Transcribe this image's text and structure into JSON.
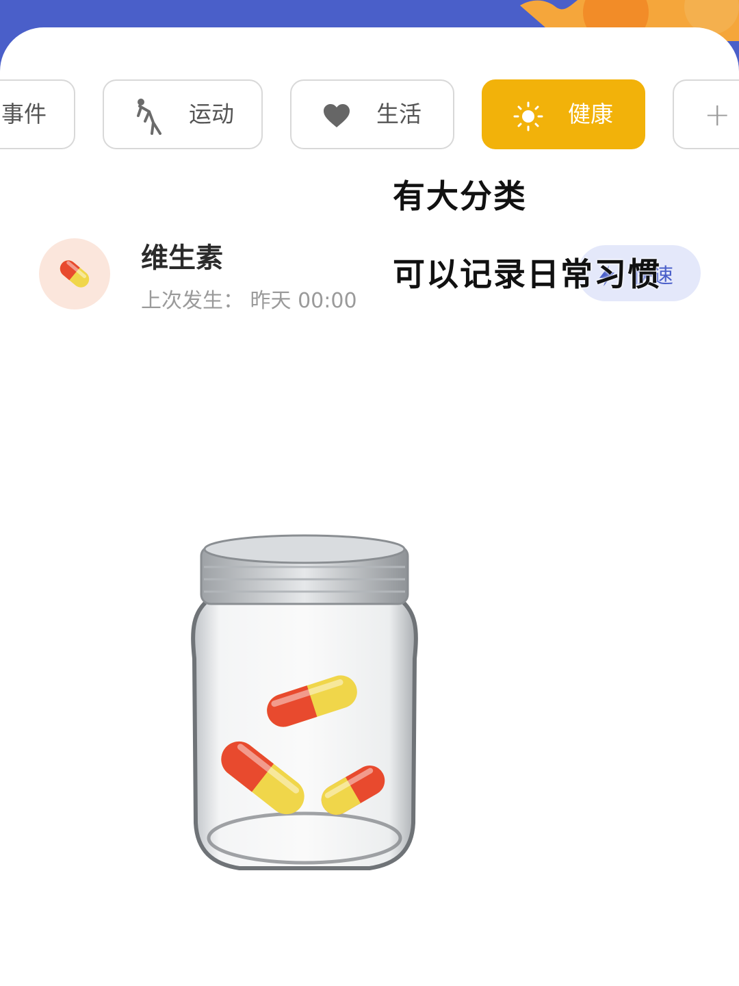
{
  "tabs": [
    {
      "label": "事件",
      "icon": "none",
      "selected": false
    },
    {
      "label": "运动",
      "icon": "stretch-person-icon",
      "selected": false
    },
    {
      "label": "生活",
      "icon": "heart-icon",
      "selected": false
    },
    {
      "label": "健康",
      "icon": "sun-icon",
      "selected": true
    },
    {
      "label": "+",
      "icon": "plus-icon",
      "selected": false
    }
  ],
  "item": {
    "title": "维生素",
    "subtitle": "上次发生：  昨天 00:00",
    "icon": "pill-icon",
    "quick_label": "快速"
  },
  "overlay": {
    "line1": "有大分类",
    "line2": "可以记录日常习惯"
  },
  "colors": {
    "header_blue": "#4a5fc9",
    "accent_yellow": "#f2b20a",
    "quick_bg": "#e4e8fa",
    "pill_red": "#e84a2e",
    "pill_yellow": "#f0d64a"
  }
}
